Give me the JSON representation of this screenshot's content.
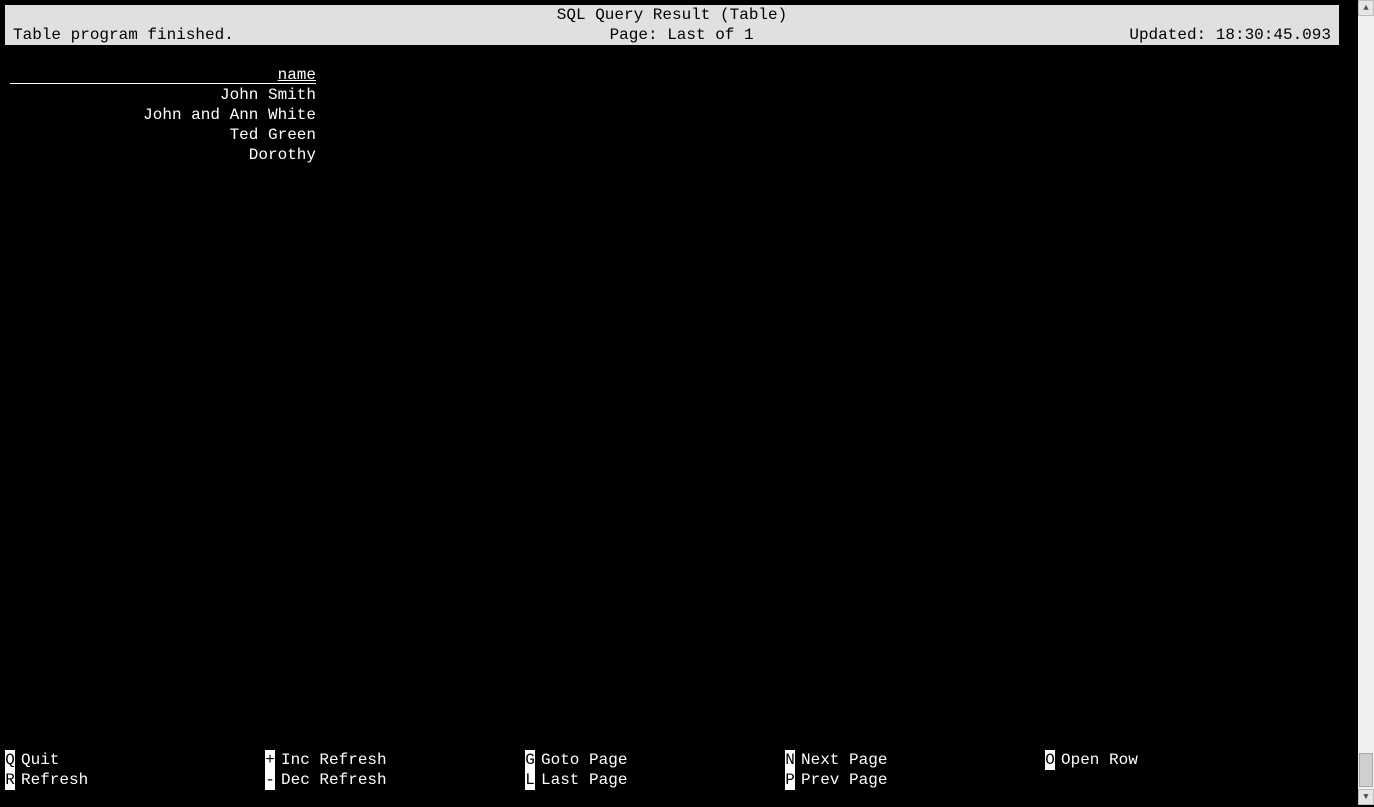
{
  "header": {
    "title": "SQL Query Result (Table)",
    "status_left": "Table program finished.",
    "status_center": "Page: Last of 1",
    "status_right": "Updated: 18:30:45.093"
  },
  "table": {
    "column_header": "name",
    "rows": [
      "John Smith",
      "John and Ann White",
      "Ted Green",
      "Dorothy"
    ]
  },
  "footer": {
    "row1": [
      {
        "key": "Q",
        "label": "Quit"
      },
      {
        "key": "+",
        "label": "Inc Refresh"
      },
      {
        "key": "G",
        "label": "Goto Page"
      },
      {
        "key": "N",
        "label": "Next Page"
      },
      {
        "key": "O",
        "label": "Open Row"
      }
    ],
    "row2": [
      {
        "key": "R",
        "label": "Refresh"
      },
      {
        "key": "-",
        "label": "Dec Refresh"
      },
      {
        "key": "L",
        "label": "Last Page"
      },
      {
        "key": "P",
        "label": "Prev Page"
      }
    ]
  }
}
